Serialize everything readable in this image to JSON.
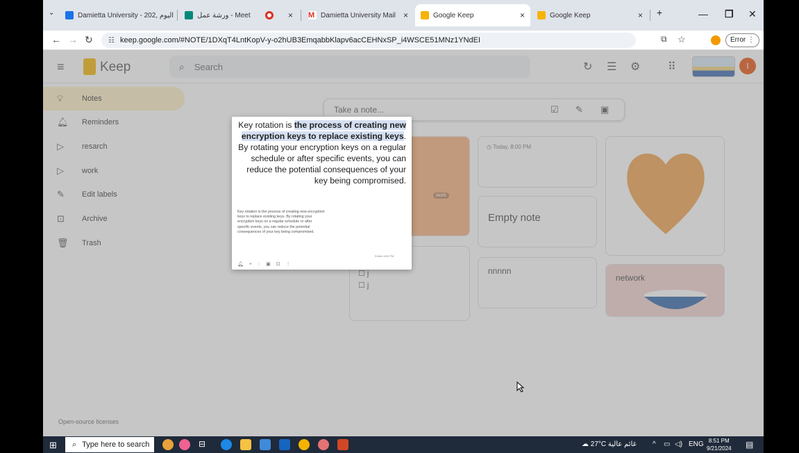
{
  "browser": {
    "tabs": [
      {
        "label": "Damietta University - اليوم ,202",
        "favicon_color": "#1a73e8"
      },
      {
        "label": "ورشة عمل - Meet",
        "favicon_color": "#00897b"
      },
      {
        "label": "",
        "favicon_color": "#d93025"
      },
      {
        "label": "Damietta University Mail",
        "favicon_color": "#d93025"
      },
      {
        "label": "Google Keep",
        "favicon_color": "#f5b400"
      },
      {
        "label": "Google Keep",
        "favicon_color": "#f5b400"
      }
    ],
    "new_tab": "+",
    "url": "keep.google.com/#NOTE/1DXqT4LntKopV-y-o2hUB3EmqabbKlapv6acCEHNxSP_i4WSCE51MNz1YNdEI",
    "error_label": "Error"
  },
  "keep": {
    "app_title": "Keep",
    "search_placeholder": "Search",
    "sidebar": [
      {
        "label": "Notes",
        "icon": "lightbulb-icon"
      },
      {
        "label": "Reminders",
        "icon": "bell-icon"
      },
      {
        "label": "resarch",
        "icon": "label-icon"
      },
      {
        "label": "work",
        "icon": "label-icon"
      },
      {
        "label": "Edit labels",
        "icon": "pencil-icon"
      },
      {
        "label": "Archive",
        "icon": "archive-icon"
      },
      {
        "label": "Trash",
        "icon": "trash-icon"
      }
    ],
    "open_source": "Open-source licenses",
    "take_note_placeholder": "Take a note...",
    "cards": {
      "reminder": "Today, 8:00 PM",
      "empty_note": "Empty note",
      "nnnnn": "nnnnn",
      "network": "network",
      "checkbox_item": "j",
      "orange_label": "work"
    },
    "avatar_letter": "I"
  },
  "popup": {
    "text_before": "Key rotation is ",
    "text_highlight": "the process of creating new encryption keys to replace existing keys",
    "text_after": ". By rotating your encryption keys on a regular schedule or after specific events, you can reduce the potential consequences of your key being compromised.",
    "small_text": "Key rotation is the process of creating new encryption keys to replace existing keys. By rotating your encryption keys on a regular schedule or after specific events, you can reduce the potential consequences of your key being compromised.",
    "edited": "Edited 8:50 PM"
  },
  "taskbar": {
    "search_placeholder": "Type here to search",
    "weather": "27°C غائم عالية",
    "lang": "ENG",
    "time": "8:51 PM",
    "date": "9/21/2024"
  }
}
